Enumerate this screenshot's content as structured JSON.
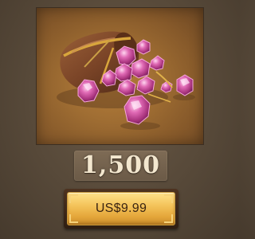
{
  "item": {
    "image_subject": "gem-pouch",
    "amount": "1,500",
    "price": "US$9.99"
  },
  "colors": {
    "background": "#574939",
    "image_bg": "#a06e33",
    "gem": "#d2559e",
    "amount_text": "#f3e7cf",
    "button_gold": "#f4c35a",
    "button_frame": "#3a2618",
    "price_text": "#3a2412"
  },
  "icons": {
    "pouch": "gem-pouch-icon",
    "gem": "gem-icon"
  }
}
